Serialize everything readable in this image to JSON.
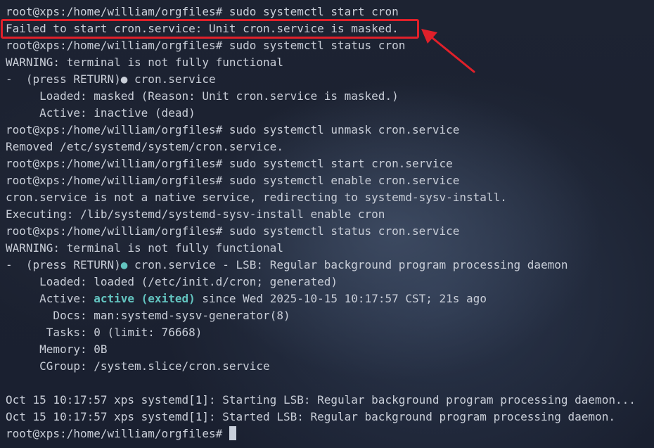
{
  "terminal": {
    "prompt": "root@xps:/home/william/orgfiles# ",
    "lines": [
      {
        "text": "root@xps:/home/william/orgfiles# sudo systemctl start cron"
      },
      {
        "text": "Failed to start cron.service: Unit cron.service is masked."
      },
      {
        "text": "root@xps:/home/william/orgfiles# sudo systemctl status cron"
      },
      {
        "text": "WARNING: terminal is not fully functional"
      },
      {
        "prefix": "-  (press RETURN)",
        "dot": "●",
        "text": " cron.service"
      },
      {
        "text": "     Loaded: masked (Reason: Unit cron.service is masked.)"
      },
      {
        "text": "     Active: inactive (dead)"
      },
      {
        "text": "root@xps:/home/william/orgfiles# sudo systemctl unmask cron.service"
      },
      {
        "text": "Removed /etc/systemd/system/cron.service."
      },
      {
        "text": "root@xps:/home/william/orgfiles# sudo systemctl start cron.service"
      },
      {
        "text": "root@xps:/home/william/orgfiles# sudo systemctl enable cron.service"
      },
      {
        "text": "cron.service is not a native service, redirecting to systemd-sysv-install."
      },
      {
        "text": "Executing: /lib/systemd/systemd-sysv-install enable cron"
      },
      {
        "text": "root@xps:/home/william/orgfiles# sudo systemctl status cron.service"
      },
      {
        "text": "WARNING: terminal is not fully functional"
      },
      {
        "prefix": "-  (press RETURN)",
        "dot": "●",
        "text": " cron.service - LSB: Regular background program processing daemon"
      },
      {
        "text": "     Loaded: loaded (/etc/init.d/cron; generated)"
      },
      {
        "label": "     Active: ",
        "status": "active (exited)",
        "text": " since Wed 2025-10-15 10:17:57 CST; 21s ago"
      },
      {
        "text": "       Docs: man:systemd-sysv-generator(8)"
      },
      {
        "text": "      Tasks: 0 (limit: 76668)"
      },
      {
        "text": "     Memory: 0B"
      },
      {
        "text": "     CGroup: /system.slice/cron.service"
      },
      {
        "text": ""
      },
      {
        "text": "Oct 15 10:17:57 xps systemd[1]: Starting LSB: Regular background program processing daemon..."
      },
      {
        "text": "Oct 15 10:17:57 xps systemd[1]: Started LSB: Regular background program processing daemon."
      }
    ]
  },
  "annotation": {
    "box_color": "#e0202a"
  },
  "colors": {
    "text": "#c9ced8",
    "active_status": "#63c4c0",
    "background": "#1b2231"
  }
}
